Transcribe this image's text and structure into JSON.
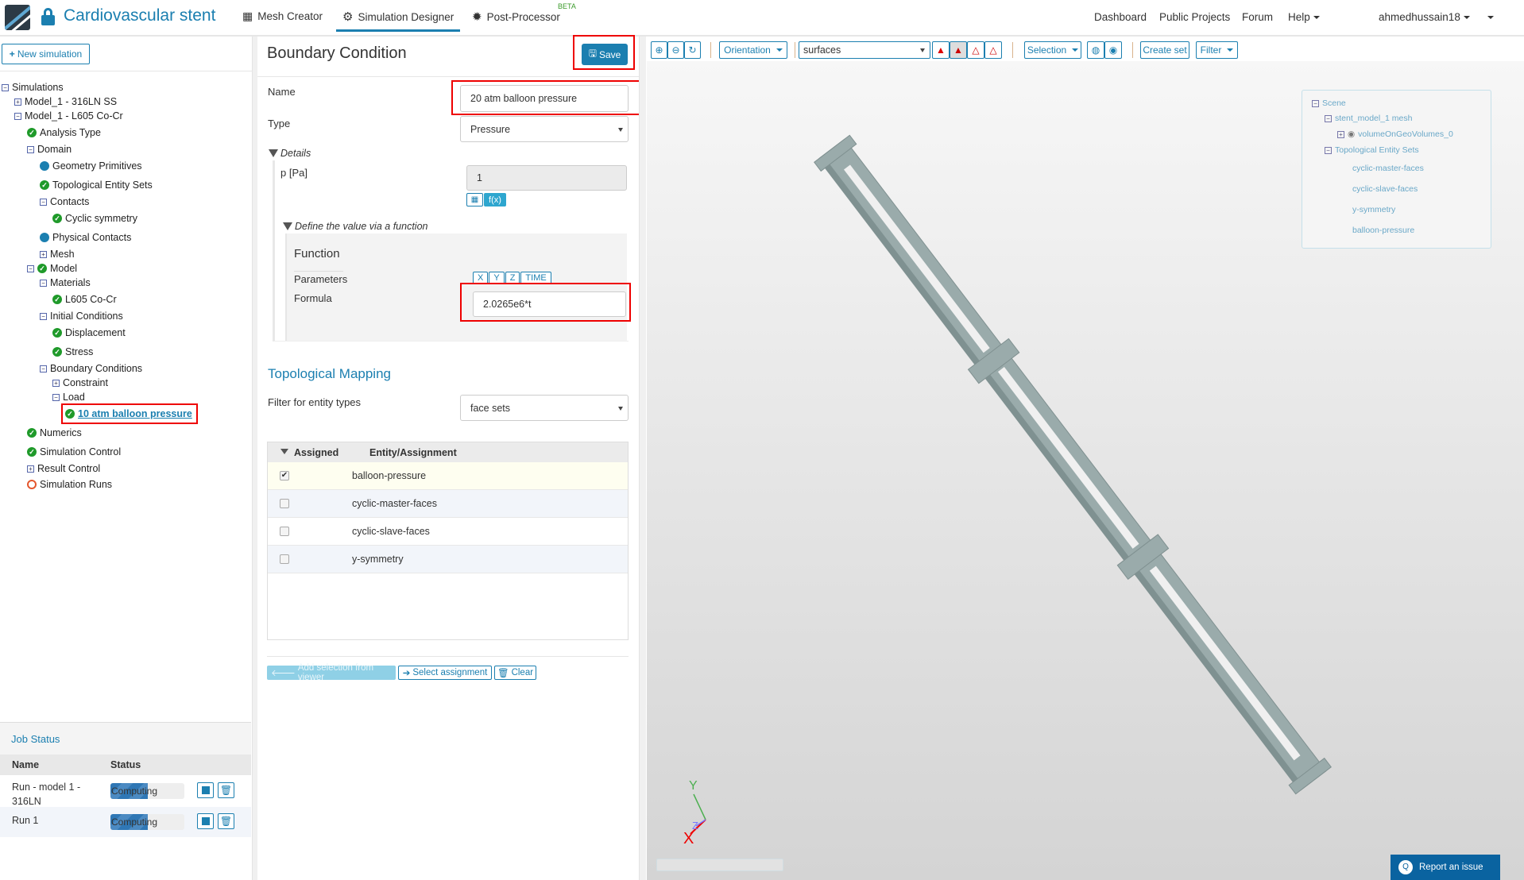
{
  "header": {
    "project_title": "Cardiovascular stent",
    "nav": [
      {
        "label": "Mesh Creator",
        "icon": "grid-icon"
      },
      {
        "label": "Simulation Designer",
        "icon": "gears-icon"
      },
      {
        "label": "Post-Processor",
        "icon": "cog-icon",
        "badge": "BETA"
      }
    ],
    "right_nav": [
      "Dashboard",
      "Public Projects",
      "Forum",
      "Help"
    ],
    "user": "ahmedhussain18"
  },
  "sidebar": {
    "new_simulation": "New simulation",
    "tree": [
      {
        "label": "Simulations",
        "icon": "minus"
      },
      {
        "label": "Model_1 - 316LN SS",
        "icon": "plus"
      },
      {
        "label": "Model_1 - L605 Co-Cr",
        "icon": "minus"
      },
      {
        "label": "Analysis Type",
        "icon": "check"
      },
      {
        "label": "Domain",
        "icon": "minus"
      },
      {
        "label": "Geometry Primitives",
        "icon": "dot"
      },
      {
        "label": "Topological Entity Sets",
        "icon": "check"
      },
      {
        "label": "Contacts",
        "icon": "minus"
      },
      {
        "label": "Cyclic symmetry",
        "icon": "check"
      },
      {
        "label": "Physical Contacts",
        "icon": "dot"
      },
      {
        "label": "Mesh",
        "icon": "plus"
      },
      {
        "label": "Model",
        "icon": "minus-check"
      },
      {
        "label": "Materials",
        "icon": "minus"
      },
      {
        "label": "L605 Co-Cr",
        "icon": "check"
      },
      {
        "label": "Initial Conditions",
        "icon": "minus"
      },
      {
        "label": "Displacement",
        "icon": "check"
      },
      {
        "label": "Stress",
        "icon": "check"
      },
      {
        "label": "Boundary Conditions",
        "icon": "minus"
      },
      {
        "label": "Constraint",
        "icon": "plus"
      },
      {
        "label": "Load",
        "icon": "minus"
      },
      {
        "label": "10 atm balloon pressure",
        "icon": "check",
        "selected": true
      },
      {
        "label": "Numerics",
        "icon": "check"
      },
      {
        "label": "Simulation Control",
        "icon": "check"
      },
      {
        "label": "Result Control",
        "icon": "plus"
      },
      {
        "label": "Simulation Runs",
        "icon": "ring"
      }
    ]
  },
  "job_status": {
    "title": "Job Status",
    "columns": [
      "Name",
      "Status"
    ],
    "rows": [
      {
        "name": "Run - model 1 - 316LN",
        "status": "Computing",
        "progress": 0.5
      },
      {
        "name": "Run 1",
        "status": "Computing",
        "progress": 0.5
      }
    ]
  },
  "form": {
    "title": "Boundary Condition",
    "save": "Save",
    "name_label": "Name",
    "name_value": "20 atm balloon pressure",
    "type_label": "Type",
    "type_value": "Pressure",
    "details": "Details",
    "p_label": "p [Pa]",
    "p_value": "1",
    "fx": "f(x)",
    "define_fn": "Define the value via a function",
    "function_title": "Function",
    "parameters_label": "Parameters",
    "params": [
      "X",
      "Y",
      "Z",
      "TIME"
    ],
    "formula_label": "Formula",
    "formula_value": "2.0265e6*t",
    "mapping_title": "Topological Mapping",
    "filter_label": "Filter for entity types",
    "filter_value": "face sets",
    "table_cols": [
      "Assigned",
      "Entity/Assignment"
    ],
    "entities": [
      {
        "name": "balloon-pressure",
        "assigned": true
      },
      {
        "name": "cyclic-master-faces",
        "assigned": false
      },
      {
        "name": "cyclic-slave-faces",
        "assigned": false
      },
      {
        "name": "y-symmetry",
        "assigned": false
      }
    ],
    "add_selection": "Add selection from viewer",
    "select_assignment": "Select assignment",
    "clear": "Clear"
  },
  "viewer": {
    "orientation": "Orientation",
    "render_mode": "surfaces",
    "selection": "Selection",
    "create_set": "Create set",
    "filter": "Filter",
    "scene": {
      "root": "Scene",
      "mesh": "stent_model_1 mesh",
      "volume": "volumeOnGeoVolumes_0",
      "sets_label": "Topological Entity Sets",
      "sets": [
        "cyclic-master-faces",
        "cyclic-slave-faces",
        "y-symmetry",
        "balloon-pressure"
      ]
    },
    "axes": {
      "x": "X",
      "y": "Y",
      "z": "Z"
    },
    "report_issue": "Report an issue",
    "colors": {
      "stent": "#9aabab",
      "accent": "#1b7fb0",
      "highlight": "#e00000"
    }
  }
}
